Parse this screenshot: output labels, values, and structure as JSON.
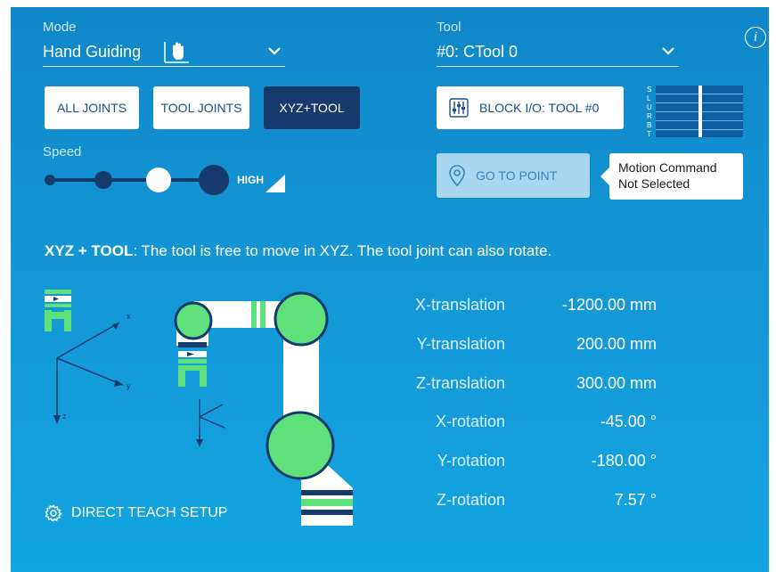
{
  "mode": {
    "label": "Mode",
    "value": "Hand Guiding"
  },
  "tool": {
    "label": "Tool",
    "value": "#0: CTool 0"
  },
  "info_icon": "i",
  "buttons": {
    "all_joints": "ALL JOINTS",
    "tool_joints": "TOOL JOINTS",
    "xyz_tool": "XYZ+TOOL",
    "block_io": "BLOCK I/O: TOOL #0",
    "go_to_point": "GO TO POINT"
  },
  "speed": {
    "label": "Speed",
    "high_label": "HIGH",
    "level": 3,
    "levels": 4
  },
  "io_bars": {
    "letters": [
      "S",
      "L",
      "U",
      "R",
      "B",
      "T"
    ]
  },
  "tooltip": {
    "line1": "Motion Command",
    "line2": "Not Selected"
  },
  "description": {
    "bold": "XYZ + TOOL",
    "text": ": The tool is free to move in XYZ. The tool joint can also rotate."
  },
  "axes": {
    "x": "x",
    "y": "y",
    "z": "z"
  },
  "readouts": [
    {
      "name": "X-translation",
      "value": "-1200.00 mm"
    },
    {
      "name": "Y-translation",
      "value": "200.00 mm"
    },
    {
      "name": "Z-translation",
      "value": "300.00 mm"
    },
    {
      "name": "X-rotation",
      "value": "-45.00 °"
    },
    {
      "name": "Y-rotation",
      "value": "-180.00 °"
    },
    {
      "name": "Z-rotation",
      "value": "7.57 °"
    }
  ],
  "setup": {
    "label": "DIRECT TEACH SETUP"
  },
  "colors": {
    "accent_green": "#5ee07a",
    "dark_navy": "#153a6b",
    "panel_blue": "#1597d6"
  }
}
